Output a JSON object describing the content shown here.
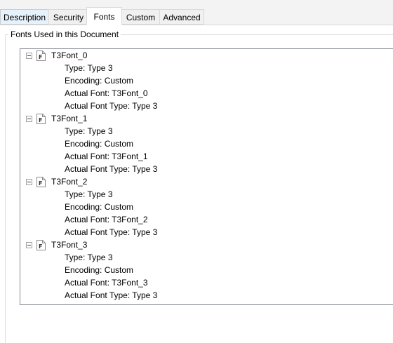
{
  "tabs": [
    {
      "label": "Description",
      "state": "hover"
    },
    {
      "label": "Security",
      "state": "normal"
    },
    {
      "label": "Fonts",
      "state": "selected"
    },
    {
      "label": "Custom",
      "state": "normal"
    },
    {
      "label": "Advanced",
      "state": "normal"
    }
  ],
  "group": {
    "title": "Fonts Used in this Document"
  },
  "fonts": [
    {
      "name": "T3Font_0",
      "expanded": true,
      "icon": "font-file-icon",
      "props": [
        "Type: Type 3",
        "Encoding: Custom",
        "Actual Font: T3Font_0",
        "Actual Font Type: Type 3"
      ]
    },
    {
      "name": "T3Font_1",
      "expanded": true,
      "icon": "font-file-icon",
      "props": [
        "Type: Type 3",
        "Encoding: Custom",
        "Actual Font: T3Font_1",
        "Actual Font Type: Type 3"
      ]
    },
    {
      "name": "T3Font_2",
      "expanded": true,
      "icon": "font-file-icon",
      "props": [
        "Type: Type 3",
        "Encoding: Custom",
        "Actual Font: T3Font_2",
        "Actual Font Type: Type 3"
      ]
    },
    {
      "name": "T3Font_3",
      "expanded": true,
      "icon": "font-file-icon",
      "props": [
        "Type: Type 3",
        "Encoding: Custom",
        "Actual Font: T3Font_3",
        "Actual Font Type: Type 3"
      ]
    }
  ],
  "colors": {
    "tab_hover": "#e5f1fb",
    "tab_inactive": "#f0f0f0",
    "border": "#d9d9d9",
    "tree_border": "#828790"
  }
}
